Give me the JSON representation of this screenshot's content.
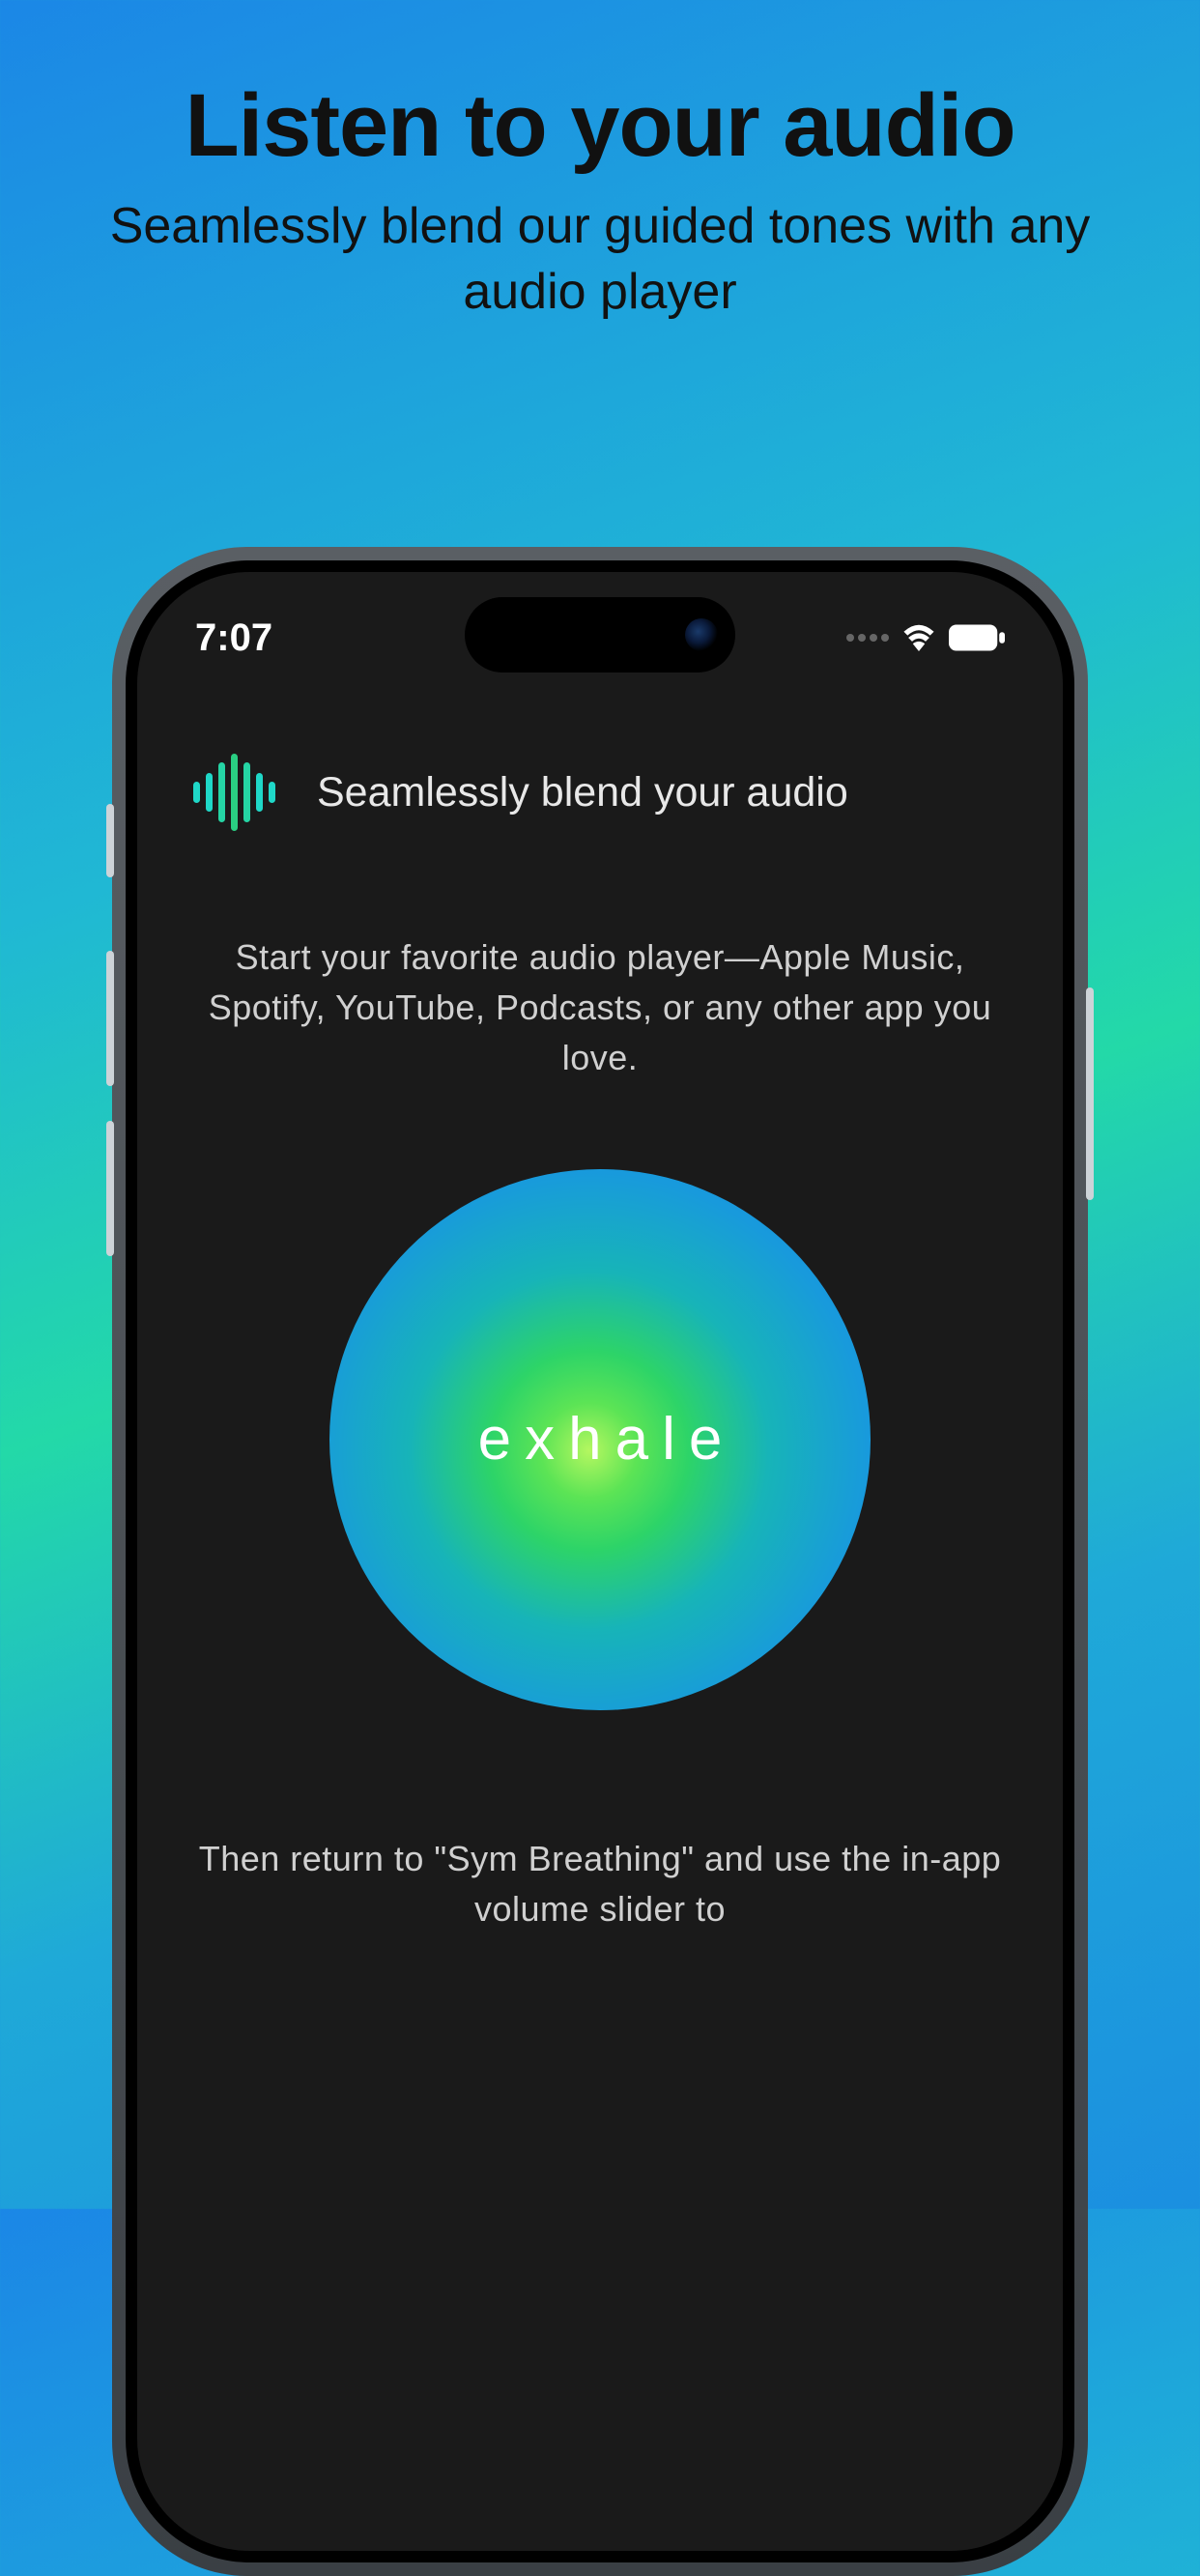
{
  "promo": {
    "title": "Listen to your audio",
    "subtitle": "Seamlessly blend our guided tones with any audio player"
  },
  "phone": {
    "status": {
      "time": "7:07"
    },
    "app": {
      "title": "Seamlessly blend your audio",
      "instruction": "Start your favorite audio player—Apple Music, Spotify, YouTube, Podcasts, or any other app you love.",
      "breathing_label": "exhale",
      "bottom_text": "Then return to \"Sym Breathing\" and use the in-app volume slider to"
    }
  }
}
